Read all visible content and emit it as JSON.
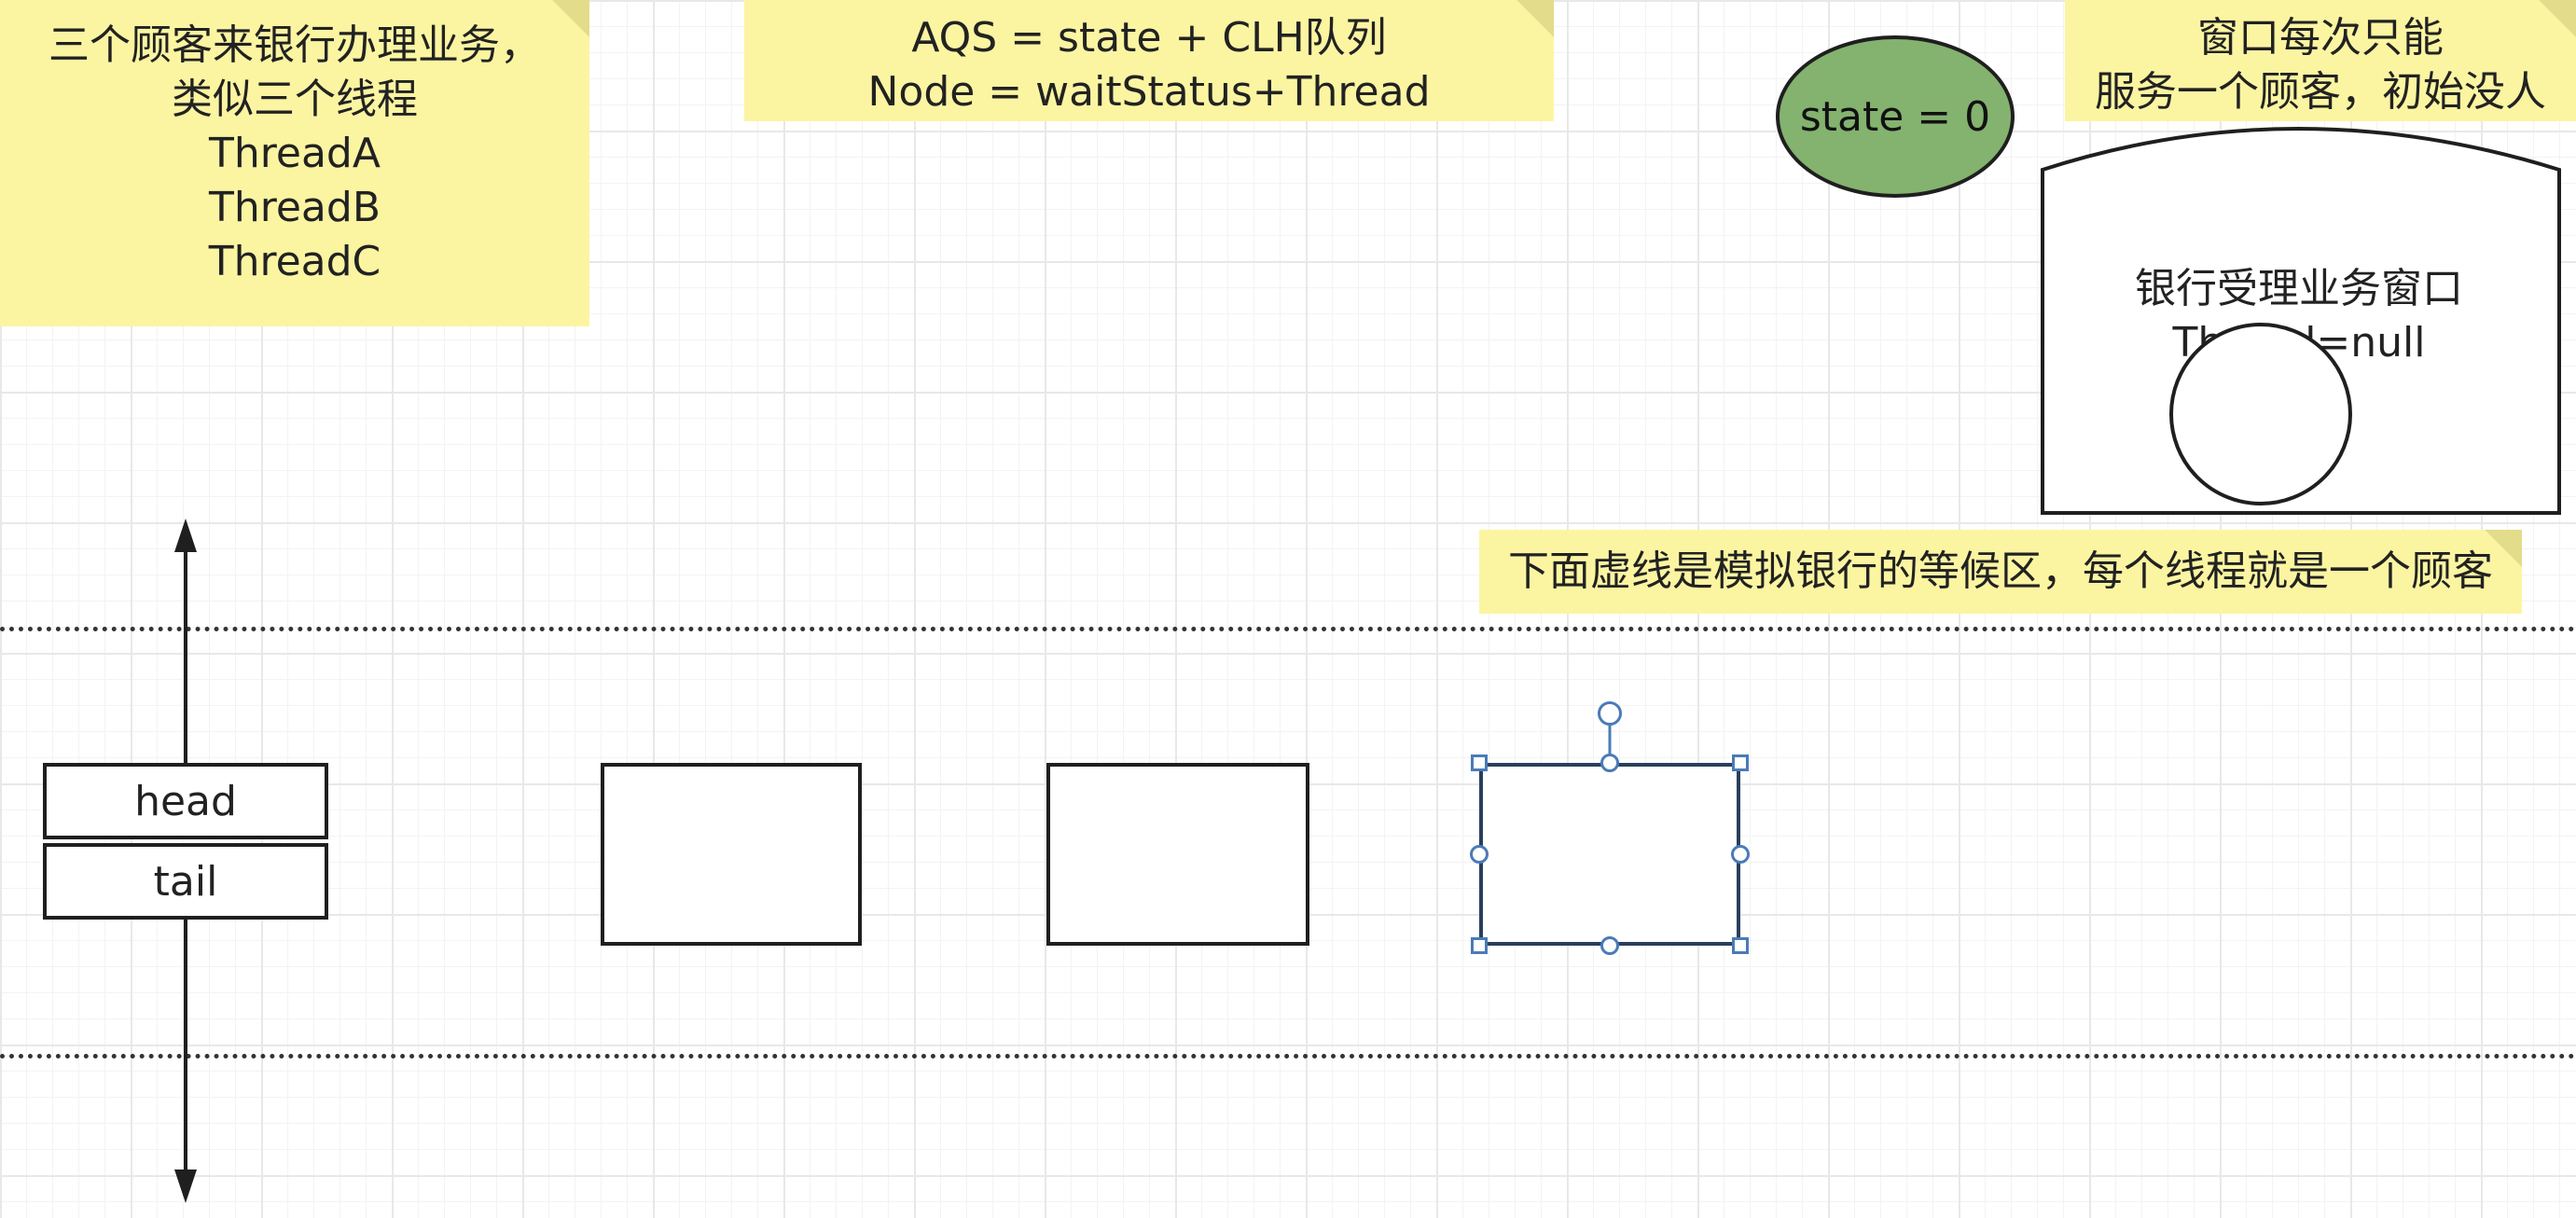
{
  "notes": {
    "customers": {
      "lines": [
        "三个顾客来银行办理业务，",
        "类似三个线程",
        "ThreadA",
        "ThreadB",
        "ThreadC"
      ]
    },
    "aqs": {
      "lines": [
        "AQS = state + CLH队列",
        "Node = waitStatus+Thread"
      ]
    },
    "window": {
      "lines": [
        "窗口每次只能",
        "服务一个顾客，初始没人"
      ]
    },
    "waiting_area": {
      "text": "下面虚线是模拟银行的等候区，每个线程就是一个顾客"
    }
  },
  "state_ellipse": {
    "label": "state = 0",
    "fill": "#84b26f"
  },
  "bank_window": {
    "title": "银行受理业务窗口",
    "thread_label": "Thread=null"
  },
  "queue": {
    "head_label": "head",
    "tail_label": "tail",
    "empty_node_count": 3
  },
  "colors": {
    "note_fill": "#fbf5a2",
    "selection_handle": "#4a7bb7",
    "stroke": "#1f1f1f"
  }
}
